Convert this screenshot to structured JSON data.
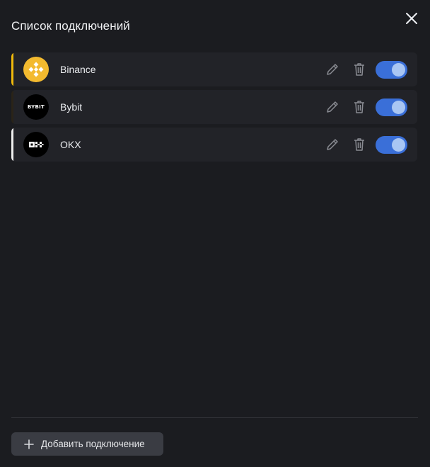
{
  "header": {
    "title": "Список подключений"
  },
  "connections": [
    {
      "name": "Binance",
      "accent": "#f0b90b",
      "logo_bg": "#f3ba2f",
      "logo_text": "",
      "enabled": true
    },
    {
      "name": "Bybit",
      "accent": "#2a2418",
      "logo_bg": "#000000",
      "logo_text": "BYBIT",
      "enabled": true
    },
    {
      "name": "OKX",
      "accent": "#eeeeee",
      "logo_bg": "#000000",
      "logo_text": "",
      "enabled": true
    }
  ],
  "footer": {
    "add_label": "Добавить подключение"
  },
  "colors": {
    "background": "#1b1c20",
    "row": "#222328",
    "toggle_on": "#3a6fd8",
    "toggle_knob": "#a9c6f3",
    "button": "#3a3c43"
  },
  "icons": {
    "close": "close-icon",
    "edit": "pencil-icon",
    "delete": "trash-icon",
    "add": "plus-icon"
  }
}
